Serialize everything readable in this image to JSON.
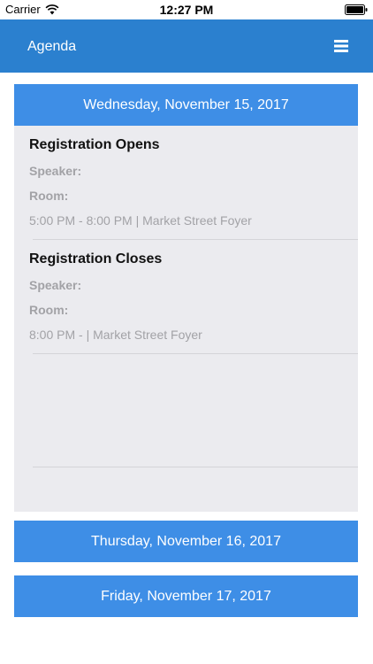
{
  "status_bar": {
    "carrier": "Carrier",
    "time": "12:27 PM"
  },
  "header": {
    "title": "Agenda",
    "menu_icon": "hamburger-menu-icon"
  },
  "colors": {
    "nav_background": "#2b80cf",
    "day_header_background": "#3e8ee6",
    "day_body_background": "#ebebef"
  },
  "days": [
    {
      "label": "Wednesday, November 15, 2017",
      "expanded": true,
      "sessions": [
        {
          "title": "Registration Opens",
          "speaker_label": "Speaker:",
          "room_label": "Room:",
          "time": "5:00 PM - 8:00 PM | Market Street Foyer"
        },
        {
          "title": "Registration Closes",
          "speaker_label": "Speaker:",
          "room_label": "Room:",
          "time": "8:00 PM -  | Market Street Foyer"
        }
      ]
    },
    {
      "label": "Thursday, November 16, 2017",
      "expanded": false
    },
    {
      "label": "Friday, November 17, 2017",
      "expanded": false
    }
  ]
}
